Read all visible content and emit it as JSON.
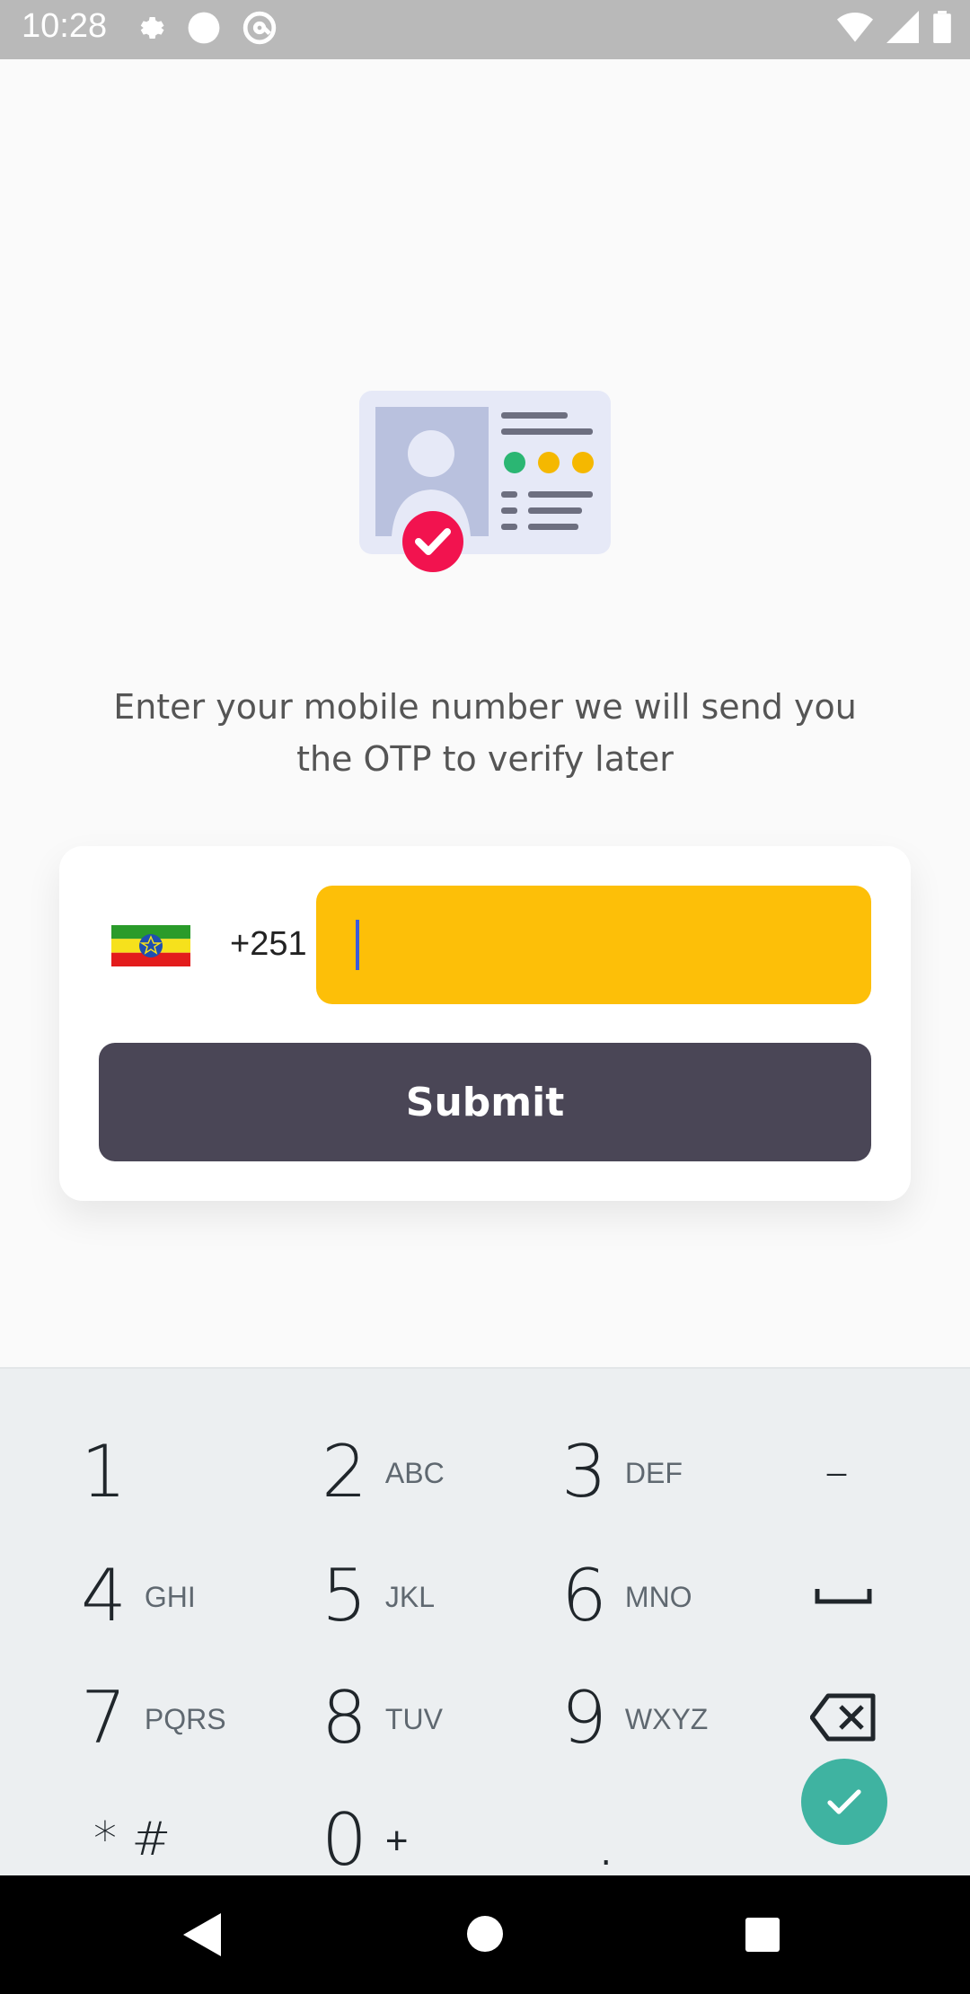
{
  "status_bar": {
    "time": "10:28",
    "icons_left": [
      "gear-icon",
      "circle-icon",
      "at-sign-icon"
    ],
    "icons_right": [
      "wifi-icon",
      "signal-icon",
      "battery-icon"
    ]
  },
  "main": {
    "instruction": "Enter your mobile number we will send you the OTP to verify later",
    "country_code": "+251",
    "phone_value": "",
    "submit_label": "Submit",
    "input_color": "#fdbf08",
    "button_color": "#4a4656"
  },
  "keyboard": {
    "keys": [
      {
        "num": "1",
        "letters": ""
      },
      {
        "num": "2",
        "letters": "ABC"
      },
      {
        "num": "3",
        "letters": "DEF"
      },
      {
        "num": "–",
        "letters": ""
      },
      {
        "num": "4",
        "letters": "GHI"
      },
      {
        "num": "5",
        "letters": "JKL"
      },
      {
        "num": "6",
        "letters": "MNO"
      },
      {
        "num": "␣",
        "letters": ""
      },
      {
        "num": "7",
        "letters": "PQRS"
      },
      {
        "num": "8",
        "letters": "TUV"
      },
      {
        "num": "9",
        "letters": "WXYZ"
      },
      {
        "num": "⌫",
        "letters": ""
      },
      {
        "num": "* #",
        "letters": ""
      },
      {
        "num": "0",
        "letters": "+"
      },
      {
        "num": ".",
        "letters": ""
      }
    ],
    "done_color": "#3fb3a1"
  }
}
